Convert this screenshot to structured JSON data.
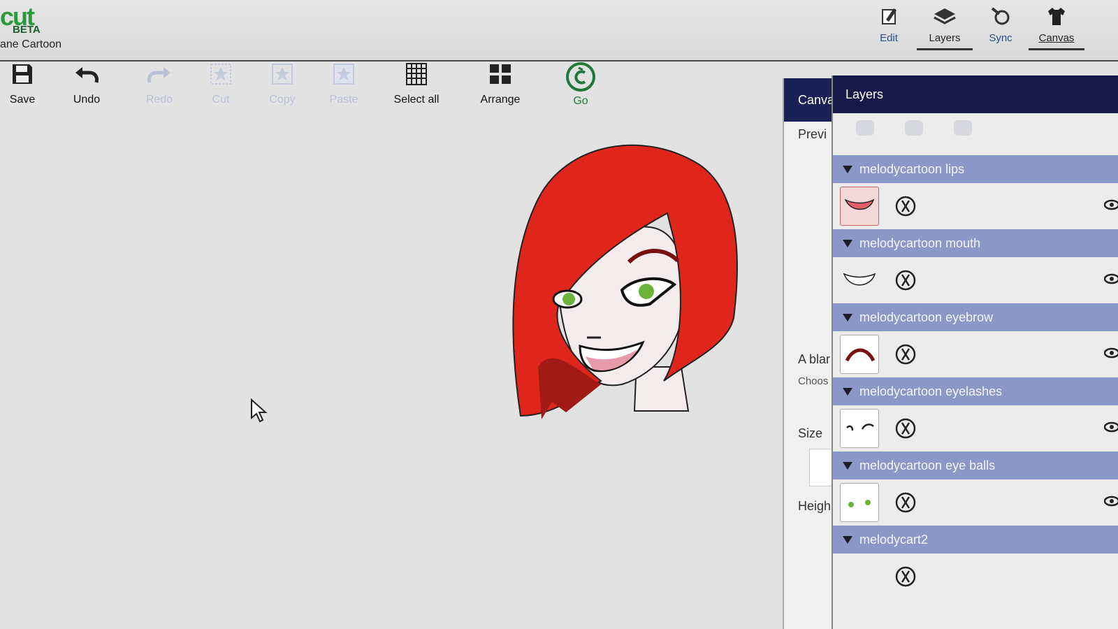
{
  "app": {
    "logo_text": "cut",
    "logo_badge": "BETA",
    "project_name": "ane Cartoon"
  },
  "top_nav": [
    {
      "label": "Edit",
      "icon": "pencil-icon"
    },
    {
      "label": "Layers",
      "icon": "layers-icon"
    },
    {
      "label": "Sync",
      "icon": "sync-icon"
    },
    {
      "label": "Canvas",
      "icon": "shirt-icon"
    }
  ],
  "toolbar": {
    "save": "Save",
    "undo": "Undo",
    "redo": "Redo",
    "cut": "Cut",
    "copy": "Copy",
    "paste": "Paste",
    "select_all": "Select all",
    "arrange": "Arrange",
    "go": "Go"
  },
  "canvas_panel": {
    "title": "Canva",
    "preview": "Previ",
    "blank": "A blar",
    "choose": "Choos",
    "size": "Size",
    "height": "Heigh"
  },
  "layers_panel": {
    "title": "Layers",
    "groups": [
      {
        "name": "melodycartoon lips"
      },
      {
        "name": "melodycartoon mouth"
      },
      {
        "name": "melodycartoon eyebrow"
      },
      {
        "name": "melodycartoon eyelashes"
      },
      {
        "name": "melodycartoon eye balls"
      },
      {
        "name": "melodycart2"
      }
    ]
  },
  "colors": {
    "hair": "#e0261c",
    "header_dark": "#151a48",
    "group_header": "#8b97c7",
    "brand_green": "#2c9a3c"
  }
}
